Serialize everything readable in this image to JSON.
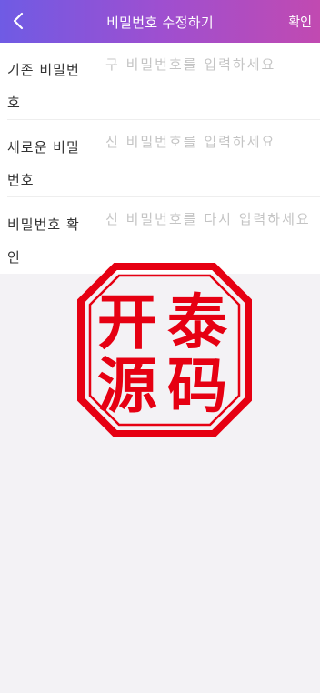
{
  "header": {
    "title": "비밀번호 수정하기",
    "confirm_label": "확인"
  },
  "form": {
    "fields": [
      {
        "label": "기존 비밀번호",
        "placeholder": "구 비밀번호를 입력하세요"
      },
      {
        "label": "새로운 비밀번호",
        "placeholder": "신 비밀번호를 입력하세요"
      },
      {
        "label": "비밀번호 확인",
        "placeholder": "신 비밀번호를 다시 입력하세요"
      }
    ]
  },
  "watermark": {
    "chars": [
      "开",
      "泰",
      "源",
      "码"
    ],
    "color": "#e60012"
  },
  "colors": {
    "header_gradient_start": "#6f5be4",
    "header_gradient_end": "#c14ab1",
    "background": "#f3f2f5"
  },
  "icons": {
    "back": "chevron-left-icon"
  }
}
